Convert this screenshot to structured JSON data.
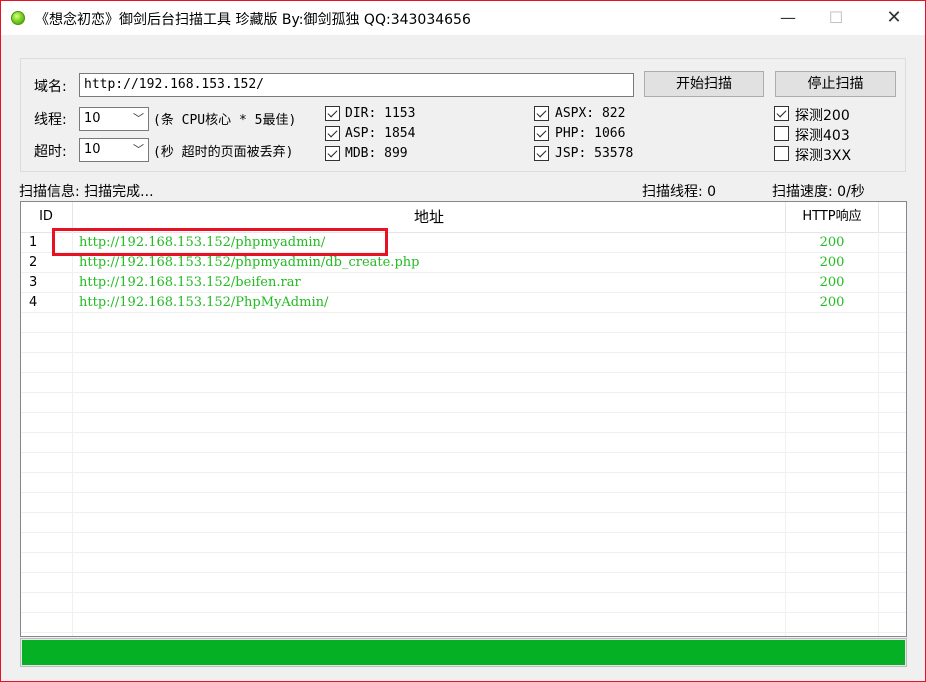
{
  "window": {
    "title": "《想念初恋》御剑后台扫描工具 珍藏版 By:御剑孤独 QQ:343034656",
    "min_label": "—",
    "max_label": "☐",
    "close_label": "✕"
  },
  "form": {
    "domain_label": "域名:",
    "domain_value": "http://192.168.153.152/",
    "start_button": "开始扫描",
    "stop_button": "停止扫描",
    "threads_label": "线程:",
    "threads_value": "10",
    "threads_hint": "(条 CPU核心 * 5最佳)",
    "timeout_label": "超时:",
    "timeout_value": "10",
    "timeout_hint": "(秒 超时的页面被丢弃)"
  },
  "dicts": [
    {
      "label": "DIR: 1153",
      "checked": true
    },
    {
      "label": "ASP: 1854",
      "checked": true
    },
    {
      "label": "MDB: 899",
      "checked": true
    },
    {
      "label": "ASPX: 822",
      "checked": true
    },
    {
      "label": "PHP: 1066",
      "checked": true
    },
    {
      "label": "JSP: 53578",
      "checked": true
    }
  ],
  "probes": [
    {
      "label": "探测200",
      "checked": true
    },
    {
      "label": "探测403",
      "checked": false
    },
    {
      "label": "探测3XX",
      "checked": false
    }
  ],
  "status": {
    "info": "扫描信息: 扫描完成...",
    "threads": "扫描线程: 0",
    "speed": "扫描速度: 0/秒"
  },
  "table": {
    "headers": {
      "id": "ID",
      "url": "地址",
      "code": "HTTP响应"
    },
    "rows": [
      {
        "id": "1",
        "url": "http://192.168.153.152/phpmyadmin/",
        "code": "200"
      },
      {
        "id": "2",
        "url": "http://192.168.153.152/phpmyadmin/db_create.php",
        "code": "200"
      },
      {
        "id": "3",
        "url": "http://192.168.153.152/beifen.rar",
        "code": "200"
      },
      {
        "id": "4",
        "url": "http://192.168.153.152/PhpMyAdmin/",
        "code": "200"
      }
    ]
  },
  "progress": {
    "value": 1.0
  },
  "colors": {
    "accent_green": "#06b025",
    "result_text": "#22bb22",
    "highlight": "#e81123"
  }
}
